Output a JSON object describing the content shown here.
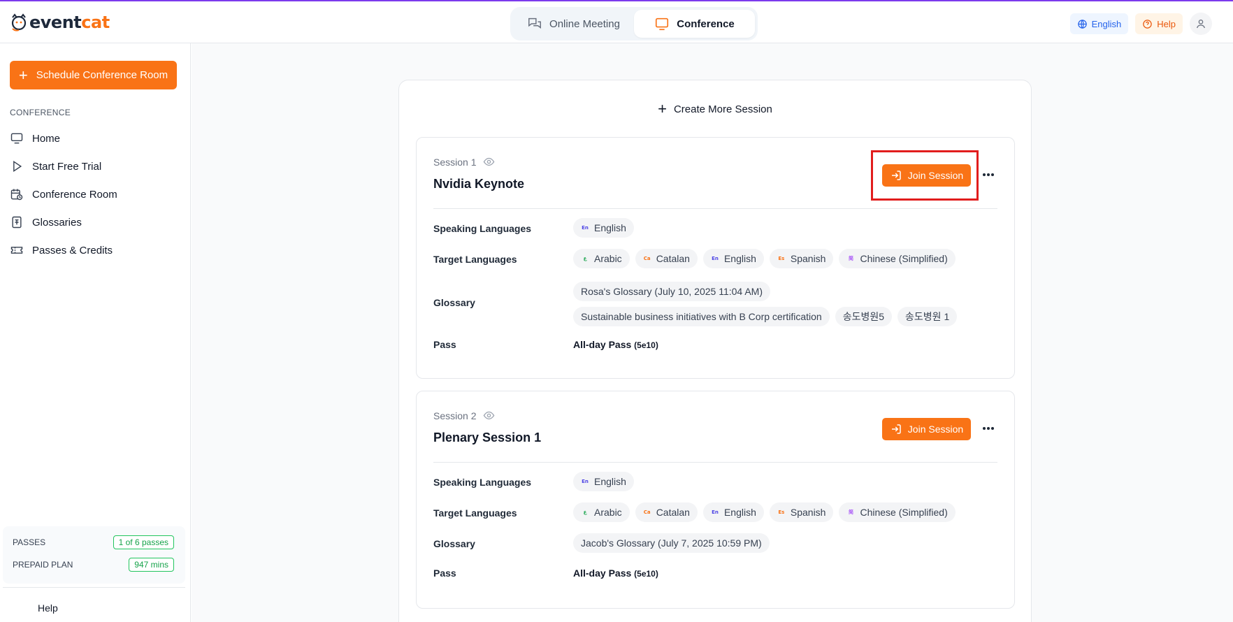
{
  "brand": {
    "part1": "event",
    "part2": "cat"
  },
  "modes": [
    {
      "label": "Online Meeting",
      "active": false
    },
    {
      "label": "Conference",
      "active": true
    }
  ],
  "topbar": {
    "language": "English",
    "help": "Help"
  },
  "sidebar": {
    "schedule_button": "Schedule Conference Room",
    "section_label": "CONFERENCE",
    "items": [
      {
        "label": "Home",
        "icon": "monitor-icon"
      },
      {
        "label": "Start Free Trial",
        "icon": "play-icon"
      },
      {
        "label": "Conference Room",
        "icon": "calendar-clock-icon"
      },
      {
        "label": "Glossaries",
        "icon": "book-icon"
      },
      {
        "label": "Passes & Credits",
        "icon": "ticket-icon"
      }
    ],
    "usage": {
      "passes_label": "PASSES",
      "passes_value": "1 of 6 passes",
      "plan_label": "PREPAID PLAN",
      "plan_value": "947 mins"
    },
    "help": "Help"
  },
  "main": {
    "create_more": "Create More Session",
    "labels": {
      "speaking": "Speaking Languages",
      "target": "Target Languages",
      "glossary": "Glossary",
      "pass": "Pass"
    },
    "join_label": "Join Session",
    "sessions": [
      {
        "number": "Session 1",
        "title": "Nvidia Keynote",
        "speaking": [
          {
            "code": "En",
            "name": "English"
          }
        ],
        "target": [
          {
            "code": "ع",
            "name": "Arabic"
          },
          {
            "code": "Ca",
            "name": "Catalan"
          },
          {
            "code": "En",
            "name": "English"
          },
          {
            "code": "Es",
            "name": "Spanish"
          },
          {
            "code": "简",
            "name": "Chinese (Simplified)"
          }
        ],
        "glossary": [
          "Rosa's Glossary (July 10, 2025 11:04 AM)",
          "Sustainable business initiatives with B Corp certification",
          "송도병원5",
          "송도병원 1"
        ],
        "pass": "All-day Pass",
        "pass_code": "(5e10)"
      },
      {
        "number": "Session 2",
        "title": "Plenary Session 1",
        "speaking": [
          {
            "code": "En",
            "name": "English"
          }
        ],
        "target": [
          {
            "code": "ع",
            "name": "Arabic"
          },
          {
            "code": "Ca",
            "name": "Catalan"
          },
          {
            "code": "En",
            "name": "English"
          },
          {
            "code": "Es",
            "name": "Spanish"
          },
          {
            "code": "简",
            "name": "Chinese (Simplified)"
          }
        ],
        "glossary": [
          "Jacob's Glossary (July 7, 2025 10:59 PM)"
        ],
        "pass": "All-day Pass",
        "pass_code": "(5e10)"
      }
    ]
  },
  "colors": {
    "accent": "#f97316",
    "highlight": "#e11d1d",
    "flag_colors": {
      "En": "#4f46e5",
      "ع": "#16a34a",
      "Ca": "#f97316",
      "Es": "#f97316",
      "简": "#a855f7"
    }
  }
}
